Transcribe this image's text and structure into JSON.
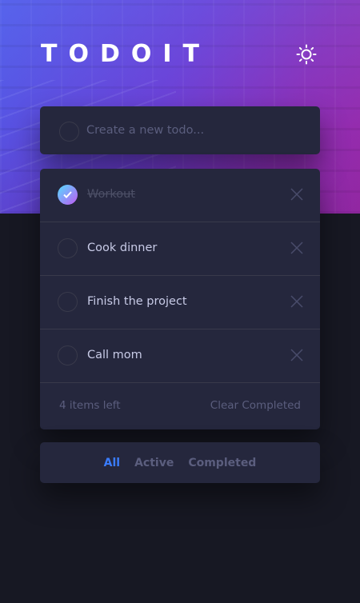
{
  "app": {
    "title": "TODOIT",
    "theme_icon": "sun-icon"
  },
  "new_todo": {
    "placeholder": "Create a new todo...",
    "value": ""
  },
  "todos": [
    {
      "label": "Workout",
      "completed": true
    },
    {
      "label": "Cook dinner",
      "completed": false
    },
    {
      "label": "Finish the project",
      "completed": false
    },
    {
      "label": "Call mom",
      "completed": false
    }
  ],
  "footer": {
    "items_left": "4 items left",
    "clear_completed": "Clear Completed"
  },
  "filters": {
    "all": "All",
    "active": "Active",
    "completed": "Completed",
    "selected": "All"
  },
  "colors": {
    "background": "#171823",
    "card": "#25273d",
    "text": "#c8cbe7",
    "muted": "#5b5e7e",
    "accent": "#3a7cfd",
    "check_gradient_start": "#55ddff",
    "check_gradient_end": "#c058f3"
  }
}
